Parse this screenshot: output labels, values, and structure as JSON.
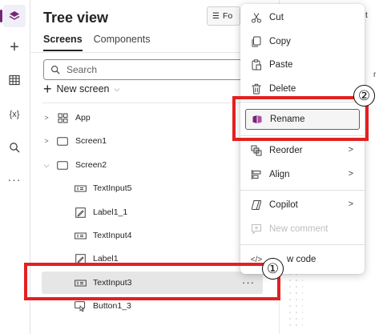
{
  "rail": {
    "items": [
      "layers-icon",
      "plus-icon",
      "table-icon",
      "variables-icon",
      "search-icon",
      "more-icon"
    ],
    "variables_label": "{x}"
  },
  "panel": {
    "title": "Tree view",
    "tabs": [
      "Screens",
      "Components"
    ],
    "search_placeholder": "Search",
    "new_screen_label": "New screen"
  },
  "tree": [
    {
      "label": "App",
      "type": "app",
      "expandable": true,
      "expanded": false
    },
    {
      "label": "Screen1",
      "type": "screen",
      "expandable": true,
      "expanded": false
    },
    {
      "label": "Screen2",
      "type": "screen",
      "expandable": true,
      "expanded": true
    },
    {
      "label": "TextInput5",
      "type": "textinput"
    },
    {
      "label": "Label1_1",
      "type": "label"
    },
    {
      "label": "TextInput4",
      "type": "textinput"
    },
    {
      "label": "Label1",
      "type": "label"
    },
    {
      "label": "TextInput3",
      "type": "textinput",
      "selected": true
    },
    {
      "label": "Button1_3",
      "type": "button"
    }
  ],
  "tree_more": "···",
  "toolbar": {
    "format_label": "Fo",
    "fragment_right": "t",
    "fragment_panel": "r"
  },
  "context_menu": {
    "items": [
      {
        "label": "Cut",
        "icon": "scissors-icon"
      },
      {
        "label": "Copy",
        "icon": "copy-icon"
      },
      {
        "label": "Paste",
        "icon": "paste-icon"
      },
      {
        "label": "Delete",
        "icon": "trash-icon"
      },
      {
        "label": "Rename",
        "icon": "rename-icon",
        "highlighted": true
      },
      {
        "label": "Reorder",
        "icon": "reorder-icon",
        "submenu": true
      },
      {
        "label": "Align",
        "icon": "align-icon",
        "submenu": true
      },
      {
        "label": "Copilot",
        "icon": "copilot-icon",
        "submenu": true
      },
      {
        "label": "New comment",
        "icon": "comment-icon",
        "disabled": true
      },
      {
        "label": "View code",
        "icon": "code-icon"
      }
    ],
    "view_code_visible": "w code"
  },
  "annotations": {
    "step1": "①",
    "step2": "②",
    "color": "#e32020"
  },
  "colors": {
    "accent": "#742774",
    "selected_row": "#e6e6e6",
    "highlight_border": "#e32020"
  }
}
